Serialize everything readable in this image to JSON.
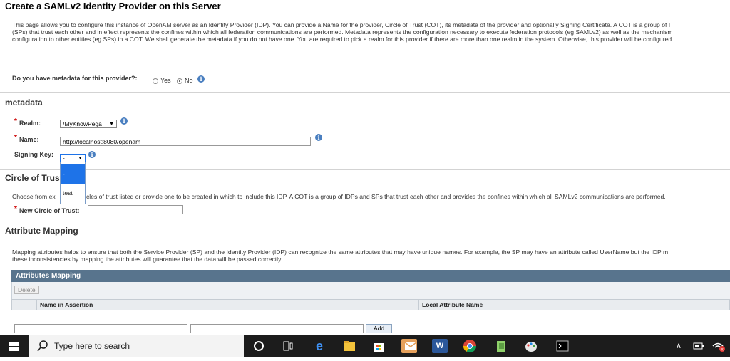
{
  "page": {
    "title": "Create a SAMLv2 Identity Provider on this Server",
    "description": [
      "This page allows you to configure this instance of OpenAM server as an Identity Provider (IDP). You can provide a Name for the provider, Circle of Trust (COT), its metadata of the provider and optionally Signing Certificate. A COT is a group of I",
      "(SPs) that trust each other and in effect represents the confines within which all federation communications are performed. Metadata represents the configuration necessary to execute federation protocols (eg SAMLv2) as well as the mechanism",
      "configuration to other entities (eg SPs) in a COT. We shall generate the metadata if you do not have one. You are required to pick a realm for this provider if there are more than one realm in the system. Otherwise, this provider will be configured"
    ]
  },
  "metadata_question": {
    "label": "Do you have metadata for this provider?:",
    "yes_label": "Yes",
    "no_label": "No",
    "selected": "No"
  },
  "metadata_section": {
    "title": "metadata",
    "realm_label": "Realm:",
    "realm_value": "/MyKnowPega",
    "name_label": "Name:",
    "name_value": "http://localhost:8080/openam",
    "signing_key_label": "Signing Key:",
    "signing_key_value": "-",
    "signing_key_options": [
      "-",
      "test"
    ]
  },
  "cot_section": {
    "title": "Circle of Trust",
    "description_start": "Choose from ex",
    "description_end": "cles of trust listed or provide one to be created in which to include this IDP. A COT is a group of IDPs and SPs that trust each other and provides the confines within which all SAMLv2 communications are performed.",
    "new_cot_label": "New Circle of Trust:",
    "new_cot_value": ""
  },
  "attr_section": {
    "title": "Attribute Mapping",
    "description": [
      "Mapping attributes helps to ensure that both the Service Provider (SP) and the Identity Provider (IDP) can recognize the same attributes that may have unique names. For example, the SP may have an attribute called UserName but the IDP m",
      "these inconsistencies by mapping the attributes will guarantee that the data will be passed correctly."
    ],
    "table_title": "Attributes Mapping",
    "delete_label": "Delete",
    "col_name_in_assertion": "Name in Assertion",
    "col_local_attribute": "Local Attribute Name",
    "add_label": "Add"
  },
  "taskbar": {
    "search_placeholder": "Type here to search",
    "apps": [
      "task-view",
      "edge",
      "file-explorer",
      "store",
      "mail",
      "word",
      "chrome",
      "notepad",
      "paint",
      "terminal"
    ]
  },
  "colors": {
    "table_header": "#58748d",
    "info_icon": "#4a7fc0",
    "required": "#cc0000",
    "dropdown_selected": "#1e73e8",
    "taskbar": "#1c1c1c"
  }
}
